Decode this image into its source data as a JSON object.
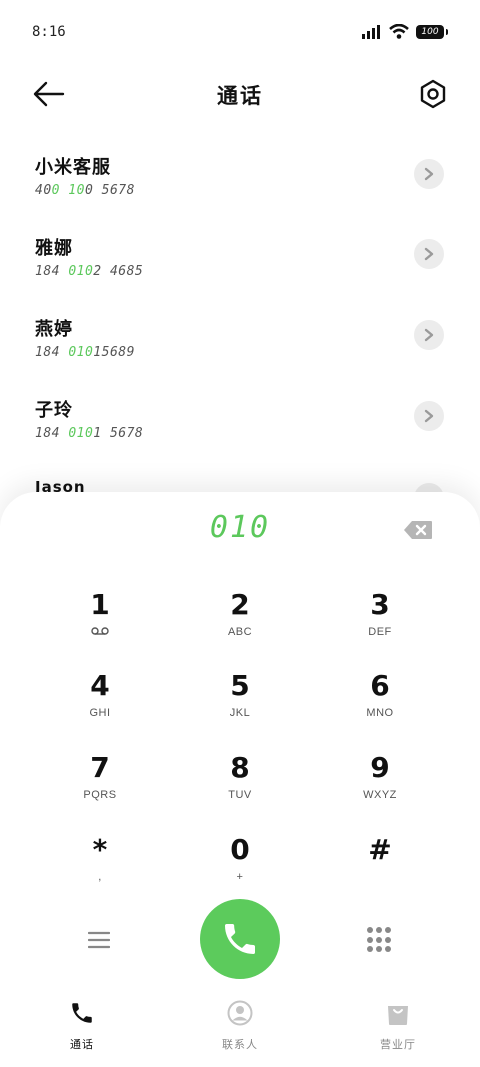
{
  "status": {
    "time": "8:16",
    "battery": "100"
  },
  "header": {
    "title": "通话"
  },
  "contacts": [
    {
      "name": "小米客服",
      "num_pre": "40",
      "num_hl": "0 10",
      "num_post": "0 5678"
    },
    {
      "name": "雅娜",
      "num_pre": "184 ",
      "num_hl": "010",
      "num_post": "2 4685"
    },
    {
      "name": "燕婷",
      "num_pre": "184 ",
      "num_hl": "010",
      "num_post": "15689"
    },
    {
      "name": "子玲",
      "num_pre": "184 ",
      "num_hl": "010",
      "num_post": "1 5678"
    },
    {
      "name": "Jason",
      "num_pre": "",
      "num_hl": "",
      "num_post": ""
    }
  ],
  "dialer": {
    "display": "010",
    "keys": [
      {
        "digit": "1",
        "letters": ""
      },
      {
        "digit": "2",
        "letters": "ABC"
      },
      {
        "digit": "3",
        "letters": "DEF"
      },
      {
        "digit": "4",
        "letters": "GHI"
      },
      {
        "digit": "5",
        "letters": "JKL"
      },
      {
        "digit": "6",
        "letters": "MNO"
      },
      {
        "digit": "7",
        "letters": "PQRS"
      },
      {
        "digit": "8",
        "letters": "TUV"
      },
      {
        "digit": "9",
        "letters": "WXYZ"
      },
      {
        "digit": "*",
        "letters": ","
      },
      {
        "digit": "0",
        "letters": "+"
      },
      {
        "digit": "#",
        "letters": ""
      }
    ]
  },
  "nav": {
    "calls": "通话",
    "contacts": "联系人",
    "store": "营业厅"
  },
  "colors": {
    "accent": "#5cc85c",
    "nav_inactive": "#c4c4c4"
  }
}
